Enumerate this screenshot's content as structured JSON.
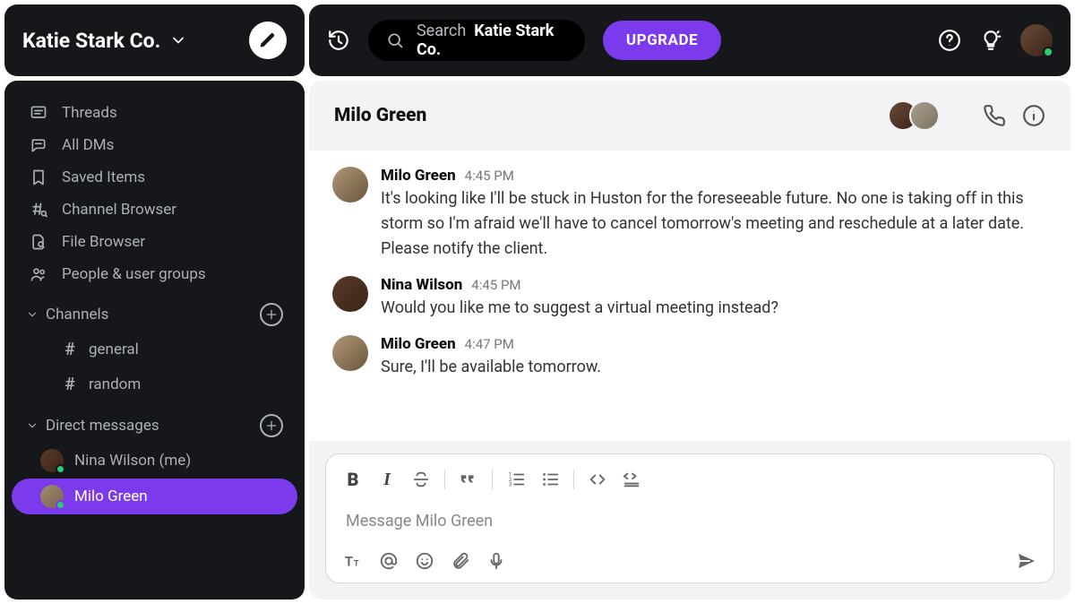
{
  "workspace": {
    "name": "Katie Stark Co."
  },
  "search": {
    "prefix": "Search",
    "name": "Katie Stark Co."
  },
  "upgrade_label": "UPGRADE",
  "nav": {
    "threads": "Threads",
    "all_dms": "All DMs",
    "saved": "Saved Items",
    "channel_browser": "Channel Browser",
    "file_browser": "File Browser",
    "people": "People & user groups"
  },
  "sections": {
    "channels_label": "Channels",
    "dms_label": "Direct messages"
  },
  "channels": [
    {
      "name": "general"
    },
    {
      "name": "random"
    }
  ],
  "dms": [
    {
      "name": "Nina Wilson (me)",
      "active": false,
      "avatar": "nina",
      "online": true
    },
    {
      "name": "Milo Green",
      "active": true,
      "avatar": "milo",
      "online": true
    }
  ],
  "chat": {
    "title": "Milo Green",
    "composer_placeholder": "Message Milo Green"
  },
  "messages": [
    {
      "author": "Milo Green",
      "time": "4:45 PM",
      "avatar": "milo",
      "text": "It's looking like I'll be stuck in Huston for the foreseeable future. No one is taking off in this storm so I'm afraid we'll have to cancel tomorrow's meeting and reschedule at a later date. Please notify the client."
    },
    {
      "author": "Nina Wilson",
      "time": "4:45 PM",
      "avatar": "nina",
      "text": "Would you like me to suggest a virtual meeting instead?"
    },
    {
      "author": "Milo Green",
      "time": "4:47 PM",
      "avatar": "milo",
      "text": "Sure, I'll be available tomorrow."
    }
  ]
}
